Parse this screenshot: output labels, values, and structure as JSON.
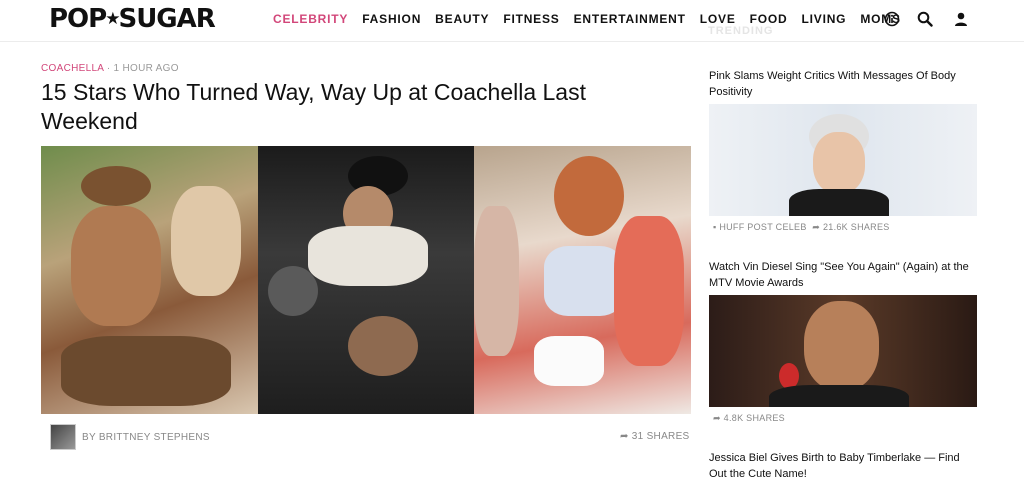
{
  "header": {
    "logo": "POPSUGAR",
    "nav": [
      "CELEBRITY",
      "FASHION",
      "BEAUTY",
      "FITNESS",
      "ENTERTAINMENT",
      "LOVE",
      "FOOD",
      "LIVING",
      "MOMS"
    ],
    "active_nav": "CELEBRITY",
    "icons": [
      "info-icon",
      "search-icon",
      "user-icon"
    ],
    "accent_color": "#d2477a"
  },
  "article": {
    "category": "COACHELLA",
    "time": "1 HOUR AGO",
    "title": "15 Stars Who Turned Way, Way Up at Coachella Last Weekend",
    "author": "BY BRITTNEY STEPHENS",
    "shares": "31 SHARES"
  },
  "sidebar": {
    "trending_label": "TRENDING",
    "items": [
      {
        "title": "Pink Slams Weight Critics With Messages Of Body Positivity",
        "source": "HUFF POST CELEB",
        "shares": "21.6K SHARES"
      },
      {
        "title": "Watch Vin Diesel Sing \"See You Again\" (Again) at the MTV Movie Awards",
        "shares": "4.8K SHARES"
      },
      {
        "title": "Jessica Biel Gives Birth to Baby Timberlake — Find Out the Cute Name!"
      }
    ]
  }
}
